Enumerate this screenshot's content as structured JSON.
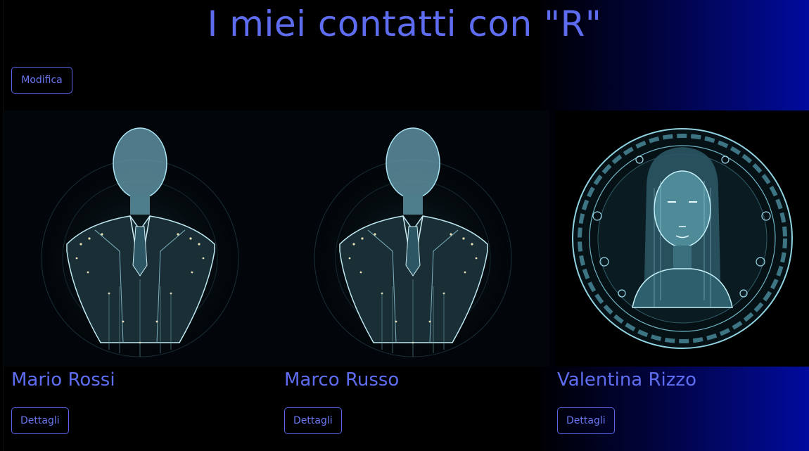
{
  "page": {
    "title": "I miei contatti con \"R\""
  },
  "toolbar": {
    "edit_label": "Modifica"
  },
  "contacts": [
    {
      "name": "Mario Rossi",
      "details_label": "Dettagli",
      "avatar_icon": "male-digital-avatar"
    },
    {
      "name": "Marco Russo",
      "details_label": "Dettagli",
      "avatar_icon": "male-digital-avatar"
    },
    {
      "name": "Valentina Rizzo",
      "details_label": "Dettagli",
      "avatar_icon": "female-digital-avatar"
    }
  ],
  "colors": {
    "accent": "#5e6cf0",
    "background": "#000000",
    "gradient_end": "#010b9e"
  }
}
